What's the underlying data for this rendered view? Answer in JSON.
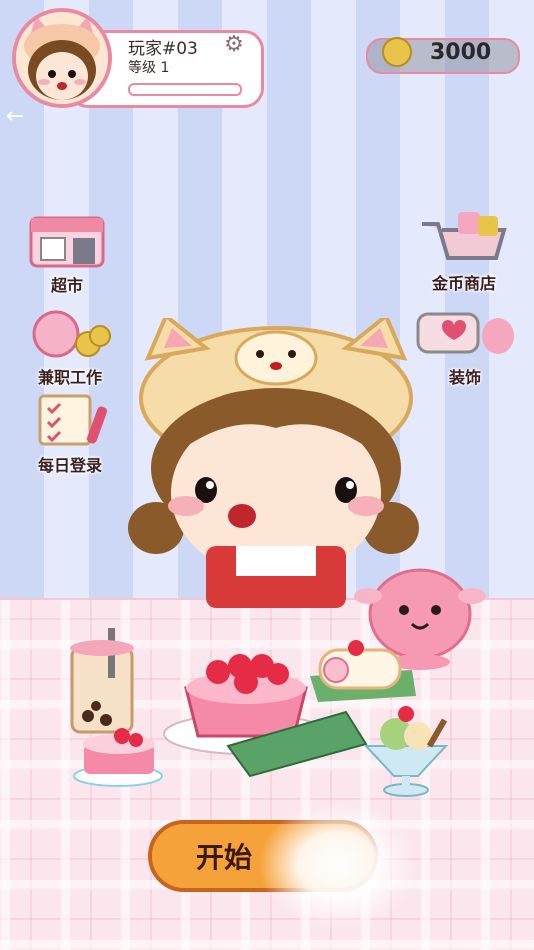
{
  "player": {
    "name": "玩家#03",
    "level": "等级  1",
    "xp_fraction": 0.0
  },
  "coins": {
    "value": "3000"
  },
  "menu": {
    "supermarket": "超市",
    "part_time": "兼职工作",
    "daily_login": "每日登录",
    "coin_shop": "金币商店",
    "decoration": "装饰"
  },
  "start_button": {
    "label": "开始"
  },
  "icons": [
    "settings-gear-icon",
    "coin-icon",
    "back-arrow-icon",
    "supermarket-icon",
    "part-time-icon",
    "daily-login-icon",
    "coin-shop-icon",
    "decoration-icon"
  ]
}
